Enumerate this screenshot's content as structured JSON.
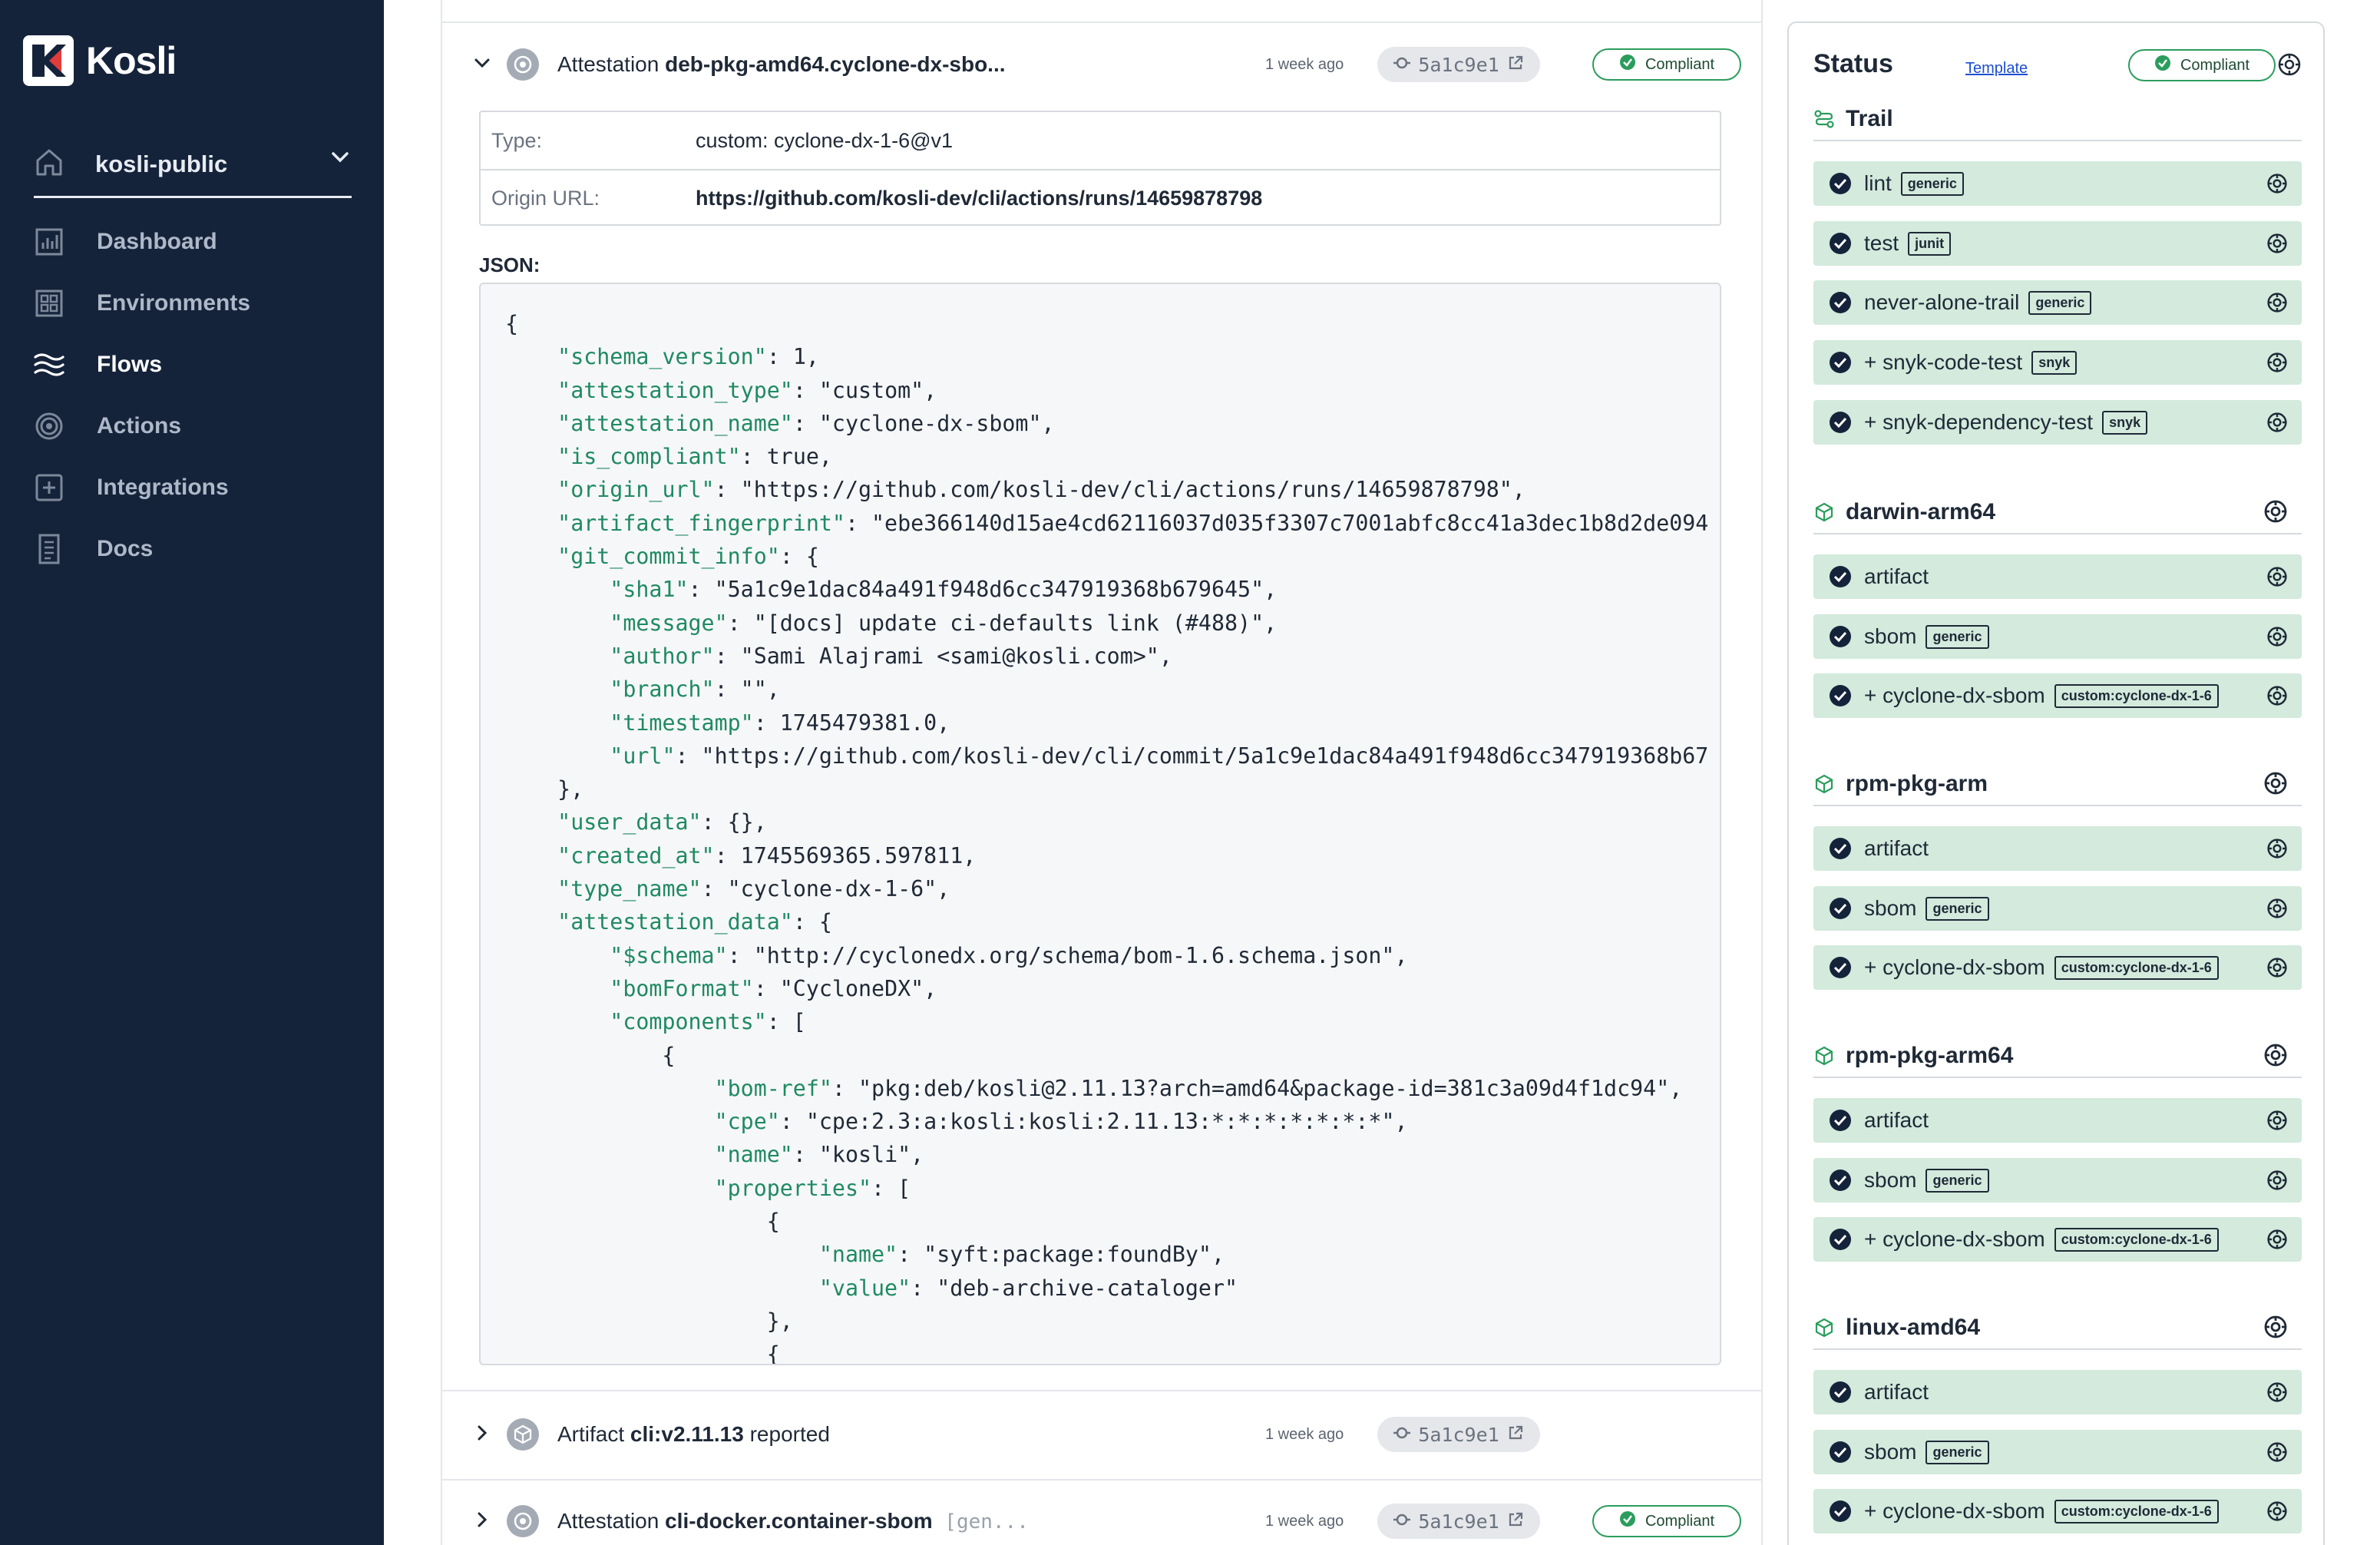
{
  "brand": {
    "name": "Kosli"
  },
  "org": {
    "name": "kosli-public"
  },
  "nav": [
    {
      "label": "Dashboard",
      "icon": "dashboard-icon"
    },
    {
      "label": "Environments",
      "icon": "environments-icon"
    },
    {
      "label": "Flows",
      "icon": "flows-icon",
      "active": true
    },
    {
      "label": "Actions",
      "icon": "actions-icon"
    },
    {
      "label": "Integrations",
      "icon": "integrations-icon"
    },
    {
      "label": "Docs",
      "icon": "docs-icon"
    }
  ],
  "attestation": {
    "prefix": "Attestation",
    "name": "deb-pkg-amd64.cyclone-dx-sbo...",
    "ago": "1 week ago",
    "commit": "5a1c9e1",
    "status": "Compliant",
    "type_label": "Type:",
    "type_value": "custom: cyclone-dx-1-6@v1",
    "origin_label": "Origin URL:",
    "origin_value": "https://github.com/kosli-dev/cli/actions/runs/14659878798",
    "json_label": "JSON:"
  },
  "json_lines": [
    "{",
    "    \"schema_version\": 1,",
    "    \"attestation_type\": \"custom\",",
    "    \"attestation_name\": \"cyclone-dx-sbom\",",
    "    \"is_compliant\": true,",
    "    \"origin_url\": \"https://github.com/kosli-dev/cli/actions/runs/14659878798\",",
    "    \"artifact_fingerprint\": \"ebe366140d15ae4cd62116037d035f3307c7001abfc8cc41a3dec1b8d2de094",
    "    \"git_commit_info\": {",
    "        \"sha1\": \"5a1c9e1dac84a491f948d6cc347919368b679645\",",
    "        \"message\": \"[docs] update ci-defaults link (#488)\",",
    "        \"author\": \"Sami Alajrami <sami@kosli.com>\",",
    "        \"branch\": \"\",",
    "        \"timestamp\": 1745479381.0,",
    "        \"url\": \"https://github.com/kosli-dev/cli/commit/5a1c9e1dac84a491f948d6cc347919368b67",
    "    },",
    "    \"user_data\": {},",
    "    \"created_at\": 1745569365.597811,",
    "    \"type_name\": \"cyclone-dx-1-6\",",
    "    \"attestation_data\": {",
    "        \"$schema\": \"http://cyclonedx.org/schema/bom-1.6.schema.json\",",
    "        \"bomFormat\": \"CycloneDX\",",
    "        \"components\": [",
    "            {",
    "                \"bom-ref\": \"pkg:deb/kosli@2.11.13?arch=amd64&package-id=381c3a09d4f1dc94\",",
    "                \"cpe\": \"cpe:2.3:a:kosli:kosli:2.11.13:*:*:*:*:*:*:*\",",
    "                \"name\": \"kosli\",",
    "                \"properties\": [",
    "                    {",
    "                        \"name\": \"syft:package:foundBy\",",
    "                        \"value\": \"deb-archive-cataloger\"",
    "                    },",
    "                    {"
  ],
  "rows": [
    {
      "kind": "Artifact",
      "name": "cli:v2.11.13",
      "suffix": " reported",
      "ago": "1 week ago",
      "commit": "5a1c9e1"
    },
    {
      "kind": "Attestation",
      "name": "cli-docker.container-sbom",
      "suffix": " [gen...",
      "ago": "1 week ago",
      "commit": "5a1c9e1",
      "status": "Compliant"
    }
  ],
  "status_panel": {
    "title": "Status",
    "template_link": "Template",
    "status": "Compliant",
    "groups": [
      {
        "name": "Trail",
        "icon": "trail-icon",
        "steps": [
          {
            "name": "lint",
            "tag": "generic"
          },
          {
            "name": "test",
            "tag": "junit"
          },
          {
            "name": "never-alone-trail",
            "tag": "generic"
          },
          {
            "name": "+ snyk-code-test",
            "tag": "snyk"
          },
          {
            "name": "+ snyk-dependency-test",
            "tag": "snyk"
          }
        ]
      },
      {
        "name": "darwin-arm64",
        "icon": "artifact-icon",
        "steps": [
          {
            "name": "artifact",
            "tag": ""
          },
          {
            "name": "sbom",
            "tag": "generic"
          },
          {
            "name": "+ cyclone-dx-sbom",
            "tag": "custom:cyclone-dx-1-6"
          }
        ]
      },
      {
        "name": "rpm-pkg-arm",
        "icon": "artifact-icon",
        "steps": [
          {
            "name": "artifact",
            "tag": ""
          },
          {
            "name": "sbom",
            "tag": "generic"
          },
          {
            "name": "+ cyclone-dx-sbom",
            "tag": "custom:cyclone-dx-1-6"
          }
        ]
      },
      {
        "name": "rpm-pkg-arm64",
        "icon": "artifact-icon",
        "steps": [
          {
            "name": "artifact",
            "tag": ""
          },
          {
            "name": "sbom",
            "tag": "generic"
          },
          {
            "name": "+ cyclone-dx-sbom",
            "tag": "custom:cyclone-dx-1-6"
          }
        ]
      },
      {
        "name": "linux-amd64",
        "icon": "artifact-icon",
        "steps": [
          {
            "name": "artifact",
            "tag": ""
          },
          {
            "name": "sbom",
            "tag": "generic"
          },
          {
            "name": "+ cyclone-dx-sbom",
            "tag": "custom:cyclone-dx-1-6"
          }
        ]
      }
    ]
  },
  "colors": {
    "sidebar": "#15233a",
    "compliant": "#2a9d5c",
    "step_bg": "#d3eadc",
    "json_key": "#1f8a62",
    "link": "#1d4fd0"
  }
}
